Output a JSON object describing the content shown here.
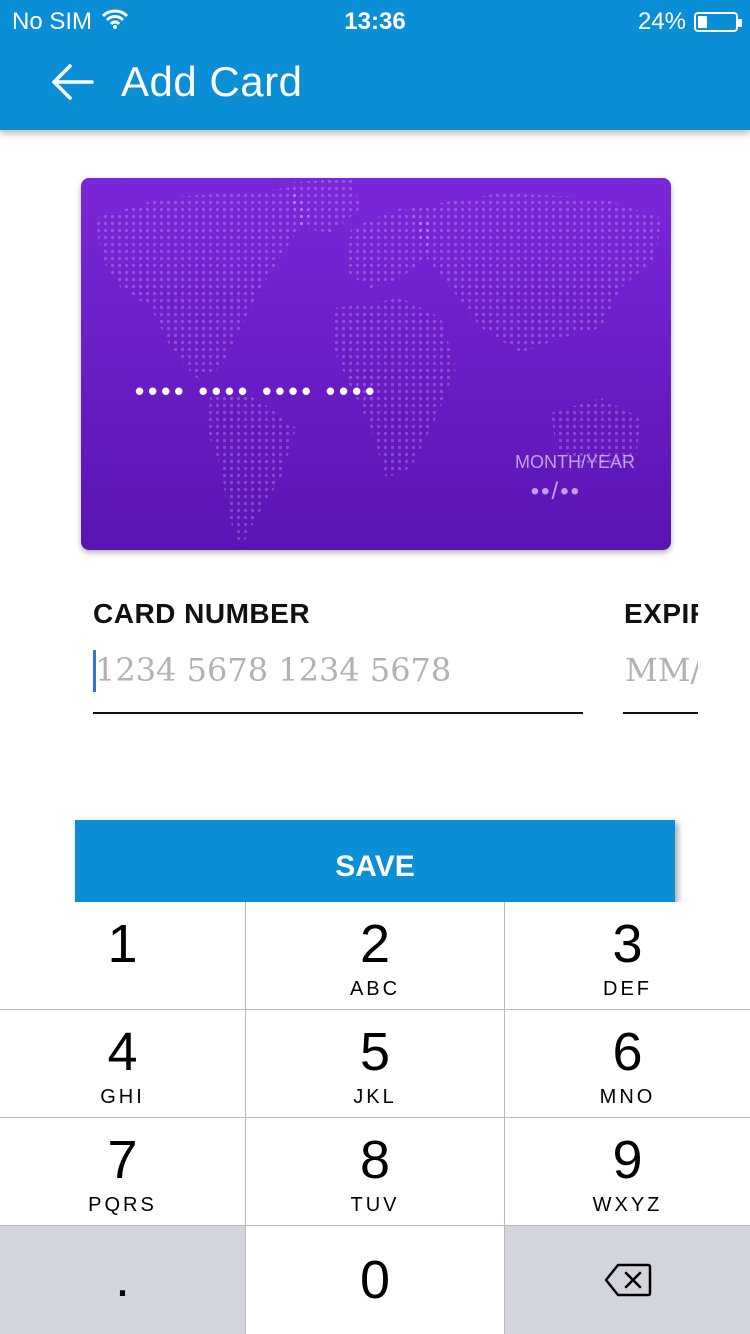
{
  "status_bar": {
    "carrier": "No SIM",
    "time": "13:36",
    "battery": "24%",
    "battery_level": 0.24,
    "wifi_icon": "wifi-icon"
  },
  "header": {
    "title": "Add Card",
    "back_icon": "arrow-left-icon",
    "color": "#0a8fd6"
  },
  "card_preview": {
    "number_mask": "•••• •••• •••• ••••",
    "expiry_label": "MONTH/YEAR",
    "expiry_mask": "••/••",
    "gradient_top": "#7a27d9",
    "gradient_bottom": "#5a14b4"
  },
  "form": {
    "card_number_label": "CARD NUMBER",
    "card_number_placeholder": "1234 5678 1234 5678",
    "card_number_value": "",
    "expiry_label": "EXPIRY",
    "expiry_placeholder": "MM/YY",
    "expiry_value": ""
  },
  "save_button": {
    "label": "SAVE"
  },
  "keypad": {
    "keys": [
      {
        "digit": "1",
        "letters": ""
      },
      {
        "digit": "2",
        "letters": "ABC"
      },
      {
        "digit": "3",
        "letters": "DEF"
      },
      {
        "digit": "4",
        "letters": "GHI"
      },
      {
        "digit": "5",
        "letters": "JKL"
      },
      {
        "digit": "6",
        "letters": "MNO"
      },
      {
        "digit": "7",
        "letters": "PQRS"
      },
      {
        "digit": "8",
        "letters": "TUV"
      },
      {
        "digit": "9",
        "letters": "WXYZ"
      }
    ],
    "decimal_key": ".",
    "zero_key": "0",
    "delete_icon": "backspace-icon"
  }
}
